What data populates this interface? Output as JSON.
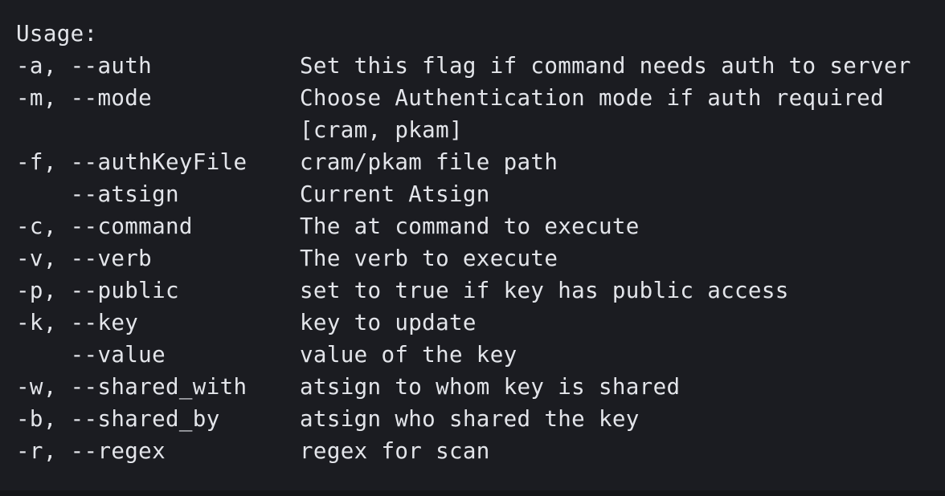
{
  "usage": {
    "header": "Usage:",
    "options": [
      {
        "flag": "-a, --auth",
        "description": "Set this flag if command needs auth to server"
      },
      {
        "flag": "-m, --mode",
        "description": "Choose Authentication mode if auth required"
      },
      {
        "flag": "",
        "description": "[cram, pkam]"
      },
      {
        "flag": "-f, --authKeyFile",
        "description": "cram/pkam file path"
      },
      {
        "flag": "    --atsign",
        "description": "Current Atsign"
      },
      {
        "flag": "-c, --command",
        "description": "The at command to execute"
      },
      {
        "flag": "-v, --verb",
        "description": "The verb to execute"
      },
      {
        "flag": "-p, --public",
        "description": "set to true if key has public access"
      },
      {
        "flag": "-k, --key",
        "description": "key to update"
      },
      {
        "flag": "    --value",
        "description": "value of the key"
      },
      {
        "flag": "-w, --shared_with",
        "description": "atsign to whom key is shared"
      },
      {
        "flag": "-b, --shared_by",
        "description": "atsign who shared the key"
      },
      {
        "flag": "-r, --regex",
        "description": "regex for scan"
      }
    ]
  }
}
